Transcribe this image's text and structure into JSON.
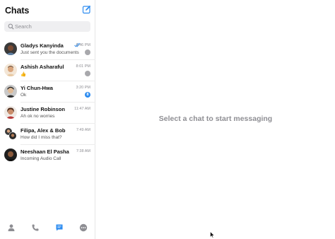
{
  "sidebar": {
    "title": "Chats",
    "search_placeholder": "Search",
    "chats": [
      {
        "name": "Gladys Kanyinda",
        "time": "6:46 PM",
        "preview": "Just sent you the documents",
        "status": "muted",
        "read_receipt": true
      },
      {
        "name": "Ashish Asharaful",
        "time": "8:01 PM",
        "preview": "👍",
        "status": "muted"
      },
      {
        "name": "Yi Chun-Hwa",
        "time": "3:20 PM",
        "preview": "Ok",
        "status": "unread",
        "unread_count": "8"
      },
      {
        "name": "Justine Robinson",
        "time": "11:47 AM",
        "preview": "Ah ok no worries",
        "status": "none"
      },
      {
        "name": "Filipa, Alex & Bob",
        "time": "7:49 AM",
        "preview": "How did I miss that?",
        "status": "none"
      },
      {
        "name": "Neeshaan El Pasha",
        "time": "7:38 AM",
        "preview": "Incoming Audio Call",
        "status": "none"
      }
    ],
    "tabs": [
      "contacts-icon",
      "calls-icon",
      "chats-icon",
      "more-icon"
    ]
  },
  "main": {
    "placeholder": "Select a chat to start messaging"
  },
  "colors": {
    "accent": "#2d8cf0",
    "muted_text": "#8e8e93"
  }
}
